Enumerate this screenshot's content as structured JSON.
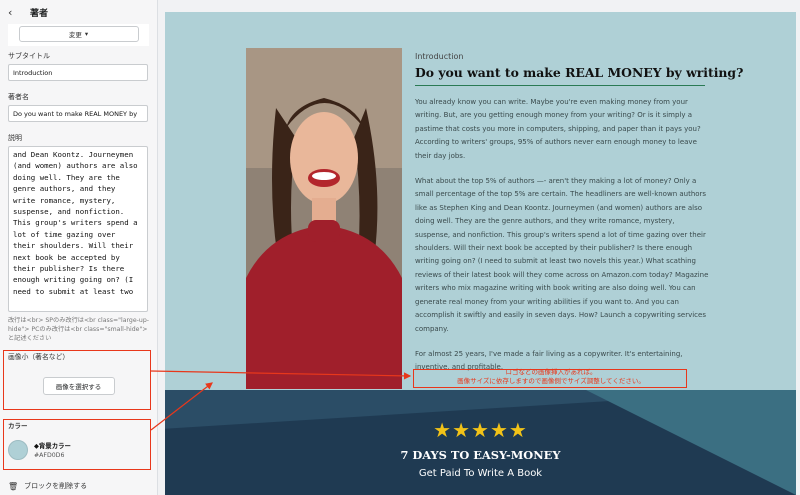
{
  "sidebar": {
    "title": "著者",
    "change_button": "変更",
    "subtitle_label": "サブタイトル",
    "subtitle_value": "Introduction",
    "author_label": "著者名",
    "author_value": "Do you want to make REAL MONEY by",
    "description_label": "説明",
    "description_value": "and Dean Koontz. Journeymen\n(and women) authors are also\ndoing well. They are the\ngenre authors, and they\nwrite romance, mystery,\nsuspense, and nonfiction.\nThis group's writers spend a\nlot of time gazing over\ntheir shoulders. Will their\nnext book be accepted by\ntheir publisher? Is there\nenough writing going on? (I\nneed to submit at least two",
    "help_text": "改行は<br> SPのみ改行は<br class=\"large-up-hide\"> PCのみ改行は<br class=\"small-hide\"> と記述ください",
    "image_label": "画像小（著名など）",
    "image_button": "画像を選択する",
    "color_label": "カラー",
    "color_name": "◆背景カラー",
    "color_hex": "#AFD0D6",
    "delete_label": "ブロックを削除する"
  },
  "preview": {
    "intro": "Introduction",
    "headline": "Do you want to make REAL MONEY by writing?",
    "paragraphs": [
      "You already know you can write. Maybe you're even making money from your writing. But, are you getting enough money from your writing? Or is it simply a pastime that costs you more in computers, shipping, and paper than it pays you? According to writers' groups, 95% of authors never earn enough money to leave their day jobs.",
      "What about the top 5% of authors —- aren't they making a lot of money? Only a small percentage of the top 5% are certain. The headliners are well-known authors like as Stephen King and Dean Koontz. Journeymen (and women) authors are also doing well. They are the genre authors, and they write romance, mystery, suspense, and nonfiction. This group's writers spend a lot of time gazing over their shoulders. Will their next book be accepted by their publisher? Is there enough writing going on? (I need to submit at least two novels this year.) What scathing reviews of their latest book will they come across on Amazon.com today? Magazine writers who mix magazine writing with book writing are also doing well. You can generate real money from your writing abilities if you want to. And you can accomplish it swiftly and easily in seven days. How? Launch a copywriting services company.",
      "For almost 25 years, I've made a fair living as a copywriter. It's entertaining, inventive, and profitable."
    ],
    "note_line1": "ロゴなどの画像挿入があれば。",
    "note_line2": "画像サイズに依存しますので画像側でサイズ調整してください。",
    "stars": "★★★★★",
    "banner_title": "7 DAYS TO EASY-MONEY",
    "banner_subtitle": "Get Paid To Write A Book"
  },
  "colors": {
    "background": "#AFD0D6",
    "annotation": "#e8371b",
    "banner": "#1f3a52",
    "star": "#f2c318"
  }
}
